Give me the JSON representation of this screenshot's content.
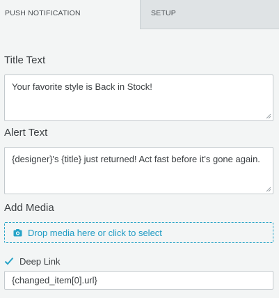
{
  "tabs": {
    "push_notification": "PUSH NOTIFICATION",
    "setup": "SETUP"
  },
  "title_text": {
    "label": "Title Text",
    "value": "Your favorite style is Back in Stock!"
  },
  "alert_text": {
    "label": "Alert Text",
    "value": "{designer}'s {title} just returned! Act fast before it's gone again."
  },
  "add_media": {
    "label": "Add Media",
    "dropzone_text": "Drop media here or click to select",
    "icon": "camera-icon"
  },
  "deep_link": {
    "label": "Deep Link",
    "checked": true,
    "value": "{changed_item[0].url}"
  },
  "colors": {
    "accent": "#26a3c7",
    "background": "#f3f5f5",
    "inactive_tab": "#dfe3e5"
  }
}
